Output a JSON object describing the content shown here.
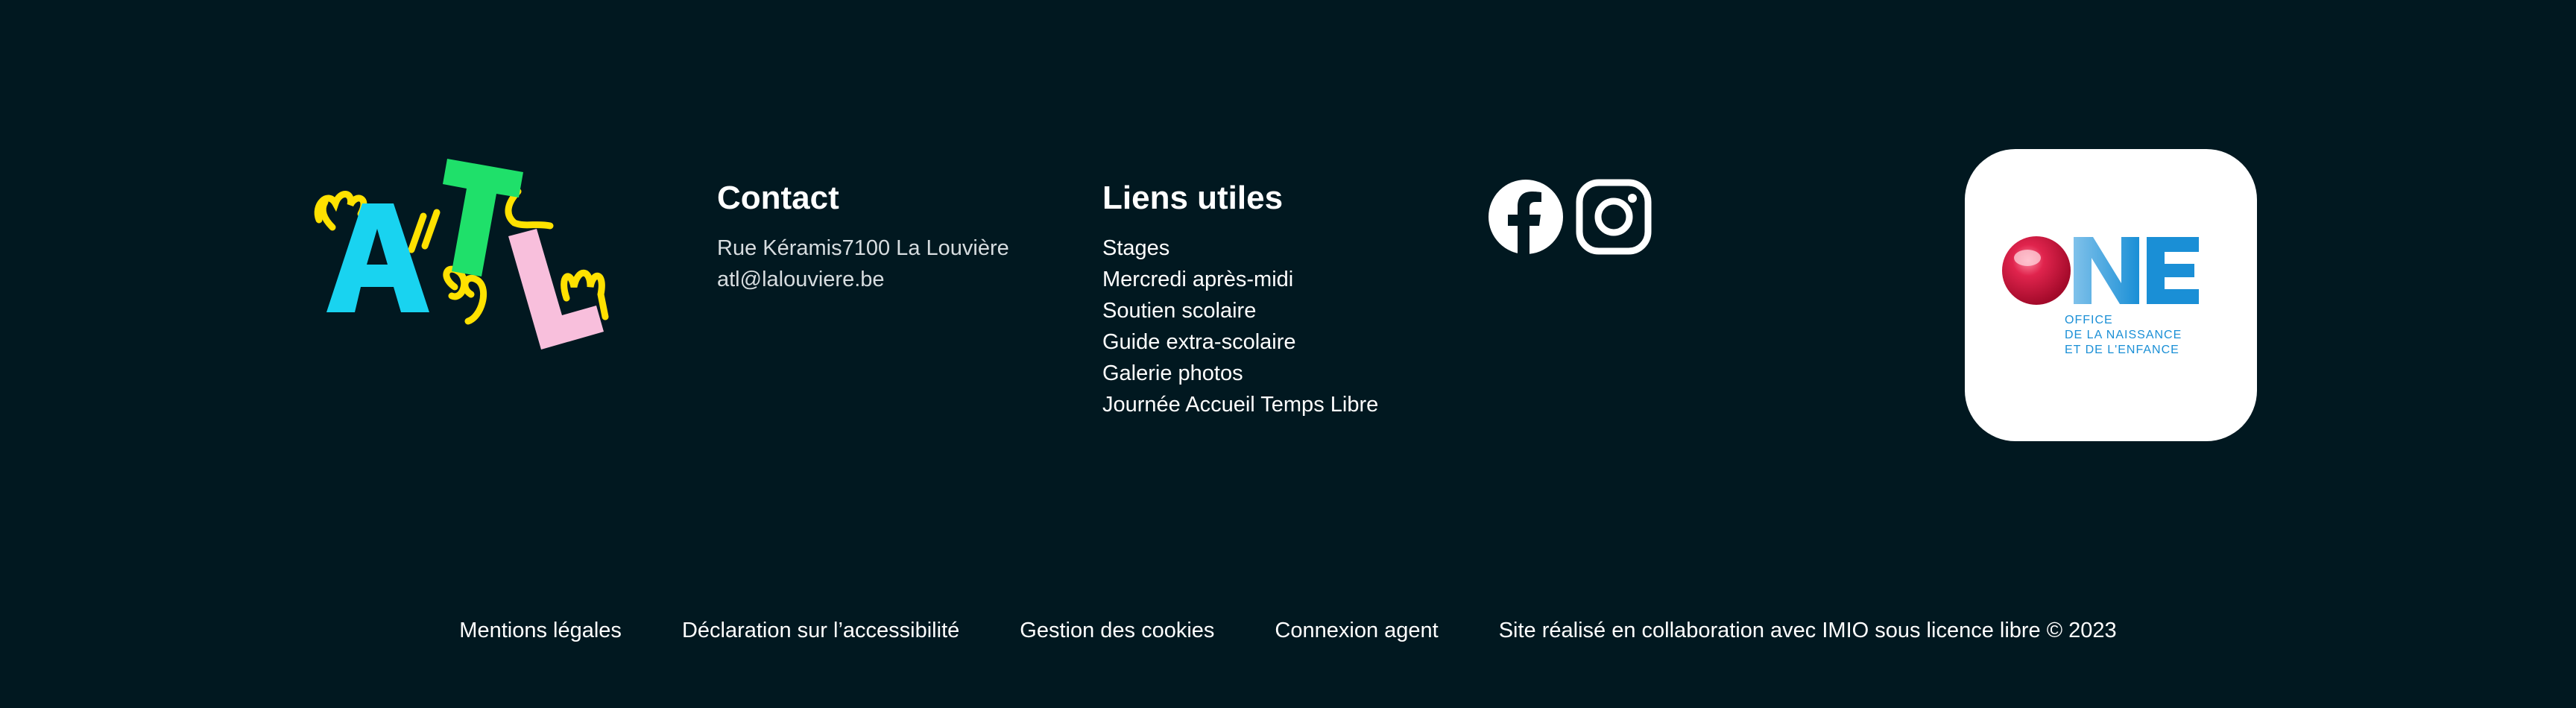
{
  "logo": {
    "alt": "ATL",
    "icon": "atl-logo"
  },
  "contact": {
    "title": "Contact",
    "address": "Rue Kéramis7100 La Louvière",
    "email": "atl@lalouviere.be"
  },
  "useful_links": {
    "title": "Liens utiles",
    "items": [
      {
        "label": "Stages"
      },
      {
        "label": "Mercredi après-midi"
      },
      {
        "label": "Soutien scolaire"
      },
      {
        "label": "Guide extra-scolaire"
      },
      {
        "label": "Galerie photos"
      },
      {
        "label": "Journée Accueil Temps Libre"
      }
    ]
  },
  "social": {
    "facebook_icon": "facebook-icon",
    "instagram_icon": "instagram-icon"
  },
  "partner": {
    "name": "ONE",
    "line1": "OFFICE",
    "line2": "DE LA NAISSANCE",
    "line3": "ET DE L'ENFANCE"
  },
  "bottom": {
    "legal": "Mentions légales",
    "accessibility": "Déclaration sur l’accessibilité",
    "cookies": "Gestion des cookies",
    "agent_login": "Connexion agent",
    "credit": "Site réalisé en collaboration avec IMIO sous licence libre © 2023"
  },
  "colors": {
    "background": "#011820",
    "atl_a": "#19d3f0",
    "atl_t": "#1fe06a",
    "atl_l": "#f8bfdc",
    "atl_doodle": "#ffe100",
    "one_blue": "#1a8fd6",
    "one_red": "#d3143c"
  }
}
